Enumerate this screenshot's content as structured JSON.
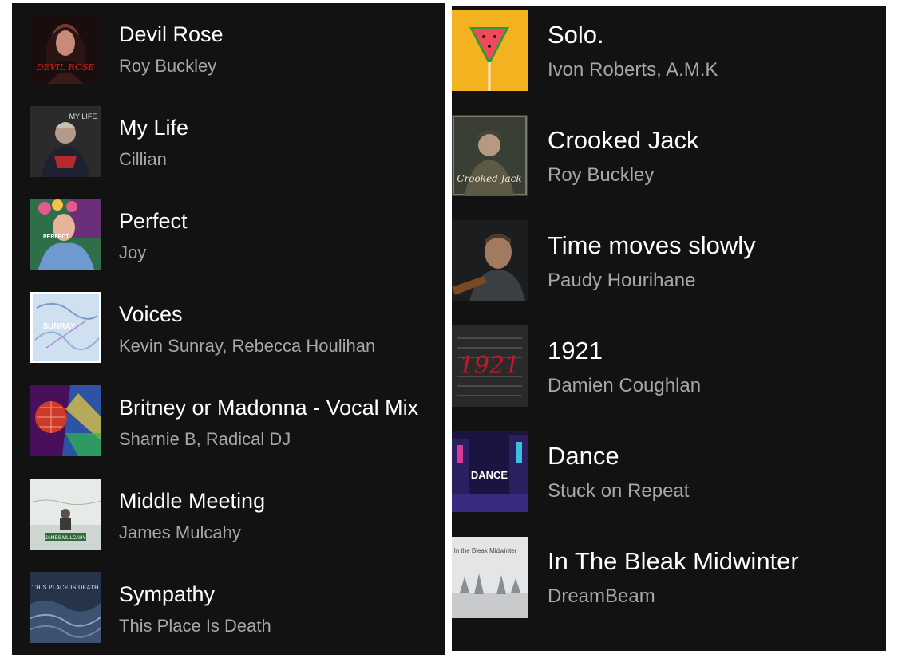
{
  "left_list": {
    "tracks": [
      {
        "title": "Devil Rose",
        "artist": "Roy Buckley",
        "art_text": "DEVIL ROSE",
        "art_icon": "portrait-woman-art"
      },
      {
        "title": "My Life",
        "artist": "Cillian",
        "art_text": "MY LIFE",
        "art_icon": "portrait-man-art"
      },
      {
        "title": "Perfect",
        "artist": "Joy",
        "art_text": "PERFECT",
        "art_icon": "flower-crown-portrait-art"
      },
      {
        "title": "Voices",
        "artist": "Kevin Sunray, Rebecca Houlihan",
        "art_text": "SUNRAY",
        "art_icon": "sketch-art"
      },
      {
        "title": "Britney or Madonna - Vocal Mix",
        "artist": "Sharnie B, Radical DJ",
        "art_text": "",
        "art_icon": "disco-ball-art"
      },
      {
        "title": "Middle Meeting",
        "artist": "James Mulcahy",
        "art_text": "JAMES MULCAHY",
        "art_icon": "snowy-field-art"
      },
      {
        "title": "Sympathy",
        "artist": "This Place Is Death",
        "art_text": "THIS PLACE IS DEATH",
        "art_icon": "stormy-sea-art"
      }
    ]
  },
  "right_list": {
    "tracks": [
      {
        "title": "Solo.",
        "artist": "Ivon Roberts, A.M.K",
        "art_text": "",
        "art_icon": "watermelon-lollipop-art"
      },
      {
        "title": "Crooked Jack",
        "artist": "Roy Buckley",
        "art_text": "Crooked Jack",
        "art_icon": "soldier-portrait-art"
      },
      {
        "title": "Time moves slowly",
        "artist": "Paudy Hourihane",
        "art_text": "",
        "art_icon": "man-with-guitar-art"
      },
      {
        "title": "1921",
        "artist": "Damien Coughlan",
        "art_text": "1921",
        "art_icon": "handwritten-letter-art"
      },
      {
        "title": "Dance",
        "artist": "Stuck on Repeat",
        "art_text": "DANCE",
        "art_icon": "neon-street-art"
      },
      {
        "title": "In The Bleak Midwinter",
        "artist": "DreamBeam",
        "art_text": "In the Bleak Midwinter",
        "art_icon": "winter-trees-art"
      }
    ]
  },
  "colors": {
    "background": "#121212",
    "title_text": "#ffffff",
    "subtitle_text": "#a7a7a7"
  }
}
